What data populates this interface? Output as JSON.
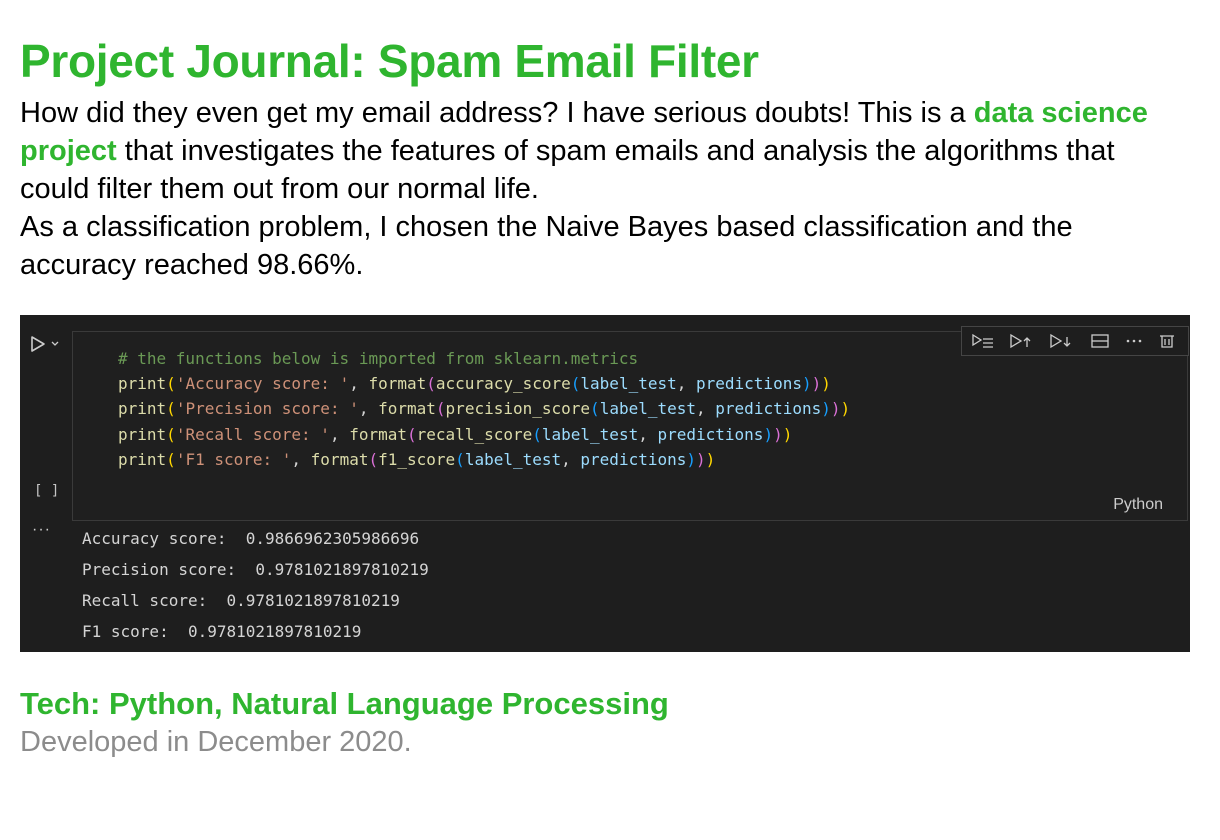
{
  "page": {
    "title": "Project Journal: Spam Email Filter",
    "intro": {
      "part1": "How did they even get my email address? I have serious doubts! This is a ",
      "highlight": "data science project",
      "part2": " that investigates the features of spam emails and analysis the algorithms that could filter them out from our normal life.",
      "line2": "As a classification problem, I chosen the Naive Bayes based classification and the accuracy reached 98.66%."
    },
    "tech": "Tech: Python, Natural Language Processing",
    "developed": "Developed in December 2020."
  },
  "notebook": {
    "exec_count": "[ ]",
    "language": "Python",
    "output_marker": "···",
    "toolbar_icons": [
      "run-above-icon",
      "run-cell-icon",
      "run-below-icon",
      "split-cell-icon",
      "more-icon",
      "delete-icon"
    ],
    "code": {
      "comment": "# the functions below is imported from sklearn.metrics",
      "print_fn": "print",
      "format_fn": "format",
      "arg1": "label_test",
      "arg2": "predictions",
      "lines": [
        {
          "label": "'Accuracy score: '",
          "metric": "accuracy_score"
        },
        {
          "label": "'Precision score: '",
          "metric": "precision_score"
        },
        {
          "label": "'Recall score: '",
          "metric": "recall_score"
        },
        {
          "label": "'F1 score: '",
          "metric": "f1_score"
        }
      ]
    },
    "output": [
      "Accuracy score:  0.9866962305986696",
      "Precision score:  0.9781021897810219",
      "Recall score:  0.9781021897810219",
      "F1 score:  0.9781021897810219"
    ]
  },
  "colors": {
    "accent": "#2fb52f",
    "muted": "#8c8c8c",
    "editor_bg": "#1e1e1e"
  }
}
